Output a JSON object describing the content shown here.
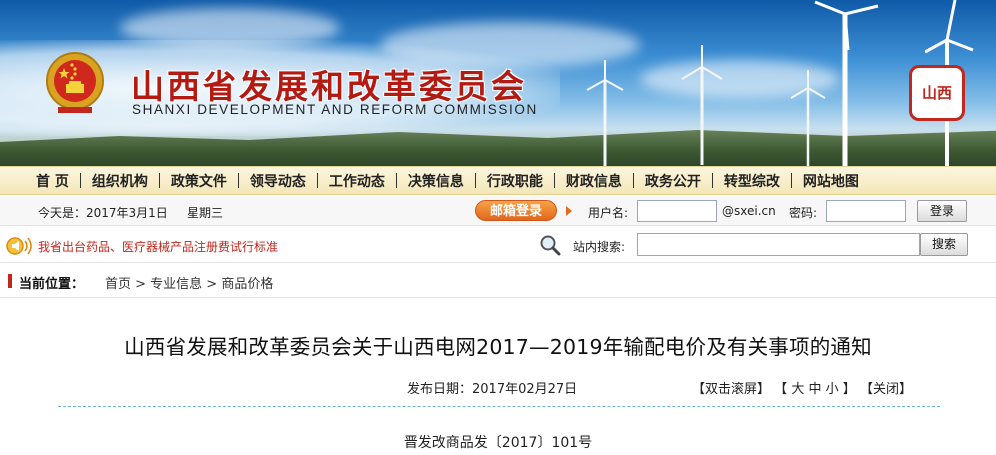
{
  "header": {
    "title": "山西省发展和改革委员会",
    "subtitle": "SHANXI DEVELOPMENT AND REFORM COMMISSION",
    "seal_text": "山西"
  },
  "nav": {
    "items": [
      {
        "label": "首 页"
      },
      {
        "label": "组织机构"
      },
      {
        "label": "政策文件"
      },
      {
        "label": "领导动态"
      },
      {
        "label": "工作动态"
      },
      {
        "label": "决策信息"
      },
      {
        "label": "行政职能"
      },
      {
        "label": "财政信息"
      },
      {
        "label": "政务公开"
      },
      {
        "label": "转型综改"
      },
      {
        "label": "网站地图"
      }
    ]
  },
  "topbar": {
    "date_text": "今天是：2017年3月1日",
    "weekday": "星期三",
    "mail_button": "邮箱登录",
    "username_label": "用户名:",
    "domain": "@sxei.cn",
    "password_label": "密码:",
    "login_button": "登录"
  },
  "searchbar": {
    "notice": "我省出台药品、医疗器械产品注册费试行标准",
    "search_label": "站内搜索:",
    "search_button": "搜索"
  },
  "breadcrumb": {
    "label": "当前位置：",
    "path": "首页 > 专业信息 > 商品价格"
  },
  "article": {
    "title": "山西省发展和改革委员会关于山西电网2017—2019年输配电价及有关事项的通知",
    "publish_date": "发布日期：2017年02月27日",
    "tool_scroll": "【双击滚屏】",
    "tool_size_open": "【",
    "size_large": "大",
    "size_medium": "中",
    "size_small": "小",
    "tool_size_close": "】",
    "tool_close": "【关闭】",
    "doc_number": "晋发改商品发〔2017〕101号"
  },
  "colors": {
    "brand_red": "#b21a12",
    "nav_bg": "#f3e6b8",
    "mail_orange": "#e1661c",
    "divider": "#6fb6c9"
  }
}
